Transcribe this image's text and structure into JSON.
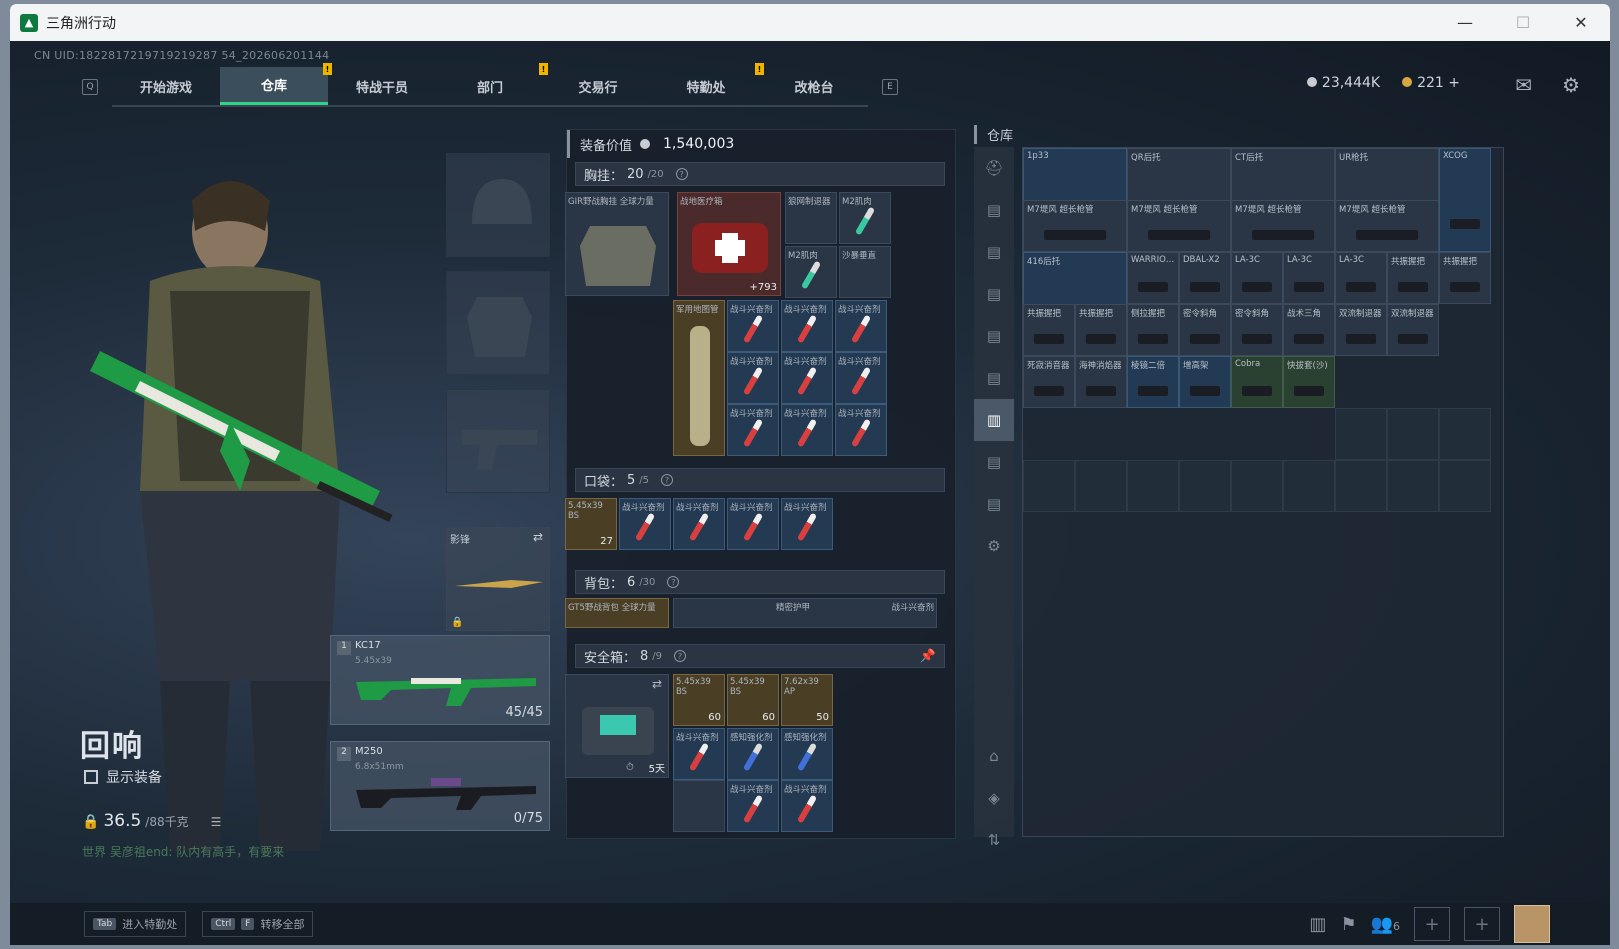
{
  "window": {
    "title": "三角洲行动",
    "controls": [
      "—",
      "☐",
      "✕"
    ]
  },
  "uid": "CN UID:1822817219719219287 54_202606201144",
  "nav": {
    "left_key": "Q",
    "right_key": "E",
    "tabs": [
      {
        "label": "开始游戏",
        "warn": false
      },
      {
        "label": "仓库",
        "warn": true,
        "active": true
      },
      {
        "label": "特战干员",
        "warn": false
      },
      {
        "label": "部门",
        "warn": true
      },
      {
        "label": "交易行",
        "warn": false
      },
      {
        "label": "特勤处",
        "warn": true
      },
      {
        "label": "改枪台",
        "warn": false
      }
    ],
    "warn_glyph": "!"
  },
  "currency": {
    "silver": "23,444K",
    "gold": "221",
    "add": "+"
  },
  "top_icons": [
    "mail-icon",
    "gear-icon"
  ],
  "character": {
    "name": "回响",
    "show_equipment": "显示装备",
    "weight": "36.5",
    "weight_max": "/88千克",
    "chat": "世界 吴彦祖end: 队内有高手，有要来"
  },
  "melee": {
    "label": "影锋"
  },
  "weapons": [
    {
      "slot": "1",
      "name": "KC17",
      "caliber": "5.45x39",
      "ammo": "45/45"
    },
    {
      "slot": "2",
      "name": "M250",
      "caliber": "6.8x51mm",
      "ammo": "0/75"
    }
  ],
  "equipment": {
    "header": "装备价值",
    "value": "1,540,003",
    "chest": {
      "label": "胸挂：",
      "count": "20",
      "cap": "/20"
    },
    "pocket": {
      "label": "口袋：",
      "count": "5",
      "cap": "/5"
    },
    "backpack": {
      "label": "背包：",
      "count": "6",
      "cap": "/30"
    },
    "safebox": {
      "label": "安全箱：",
      "count": "8",
      "cap": "/9",
      "timer": "5天"
    },
    "items": {
      "rig": "GIR野战胸挂 全球力量",
      "medkit": "战地医疗箱",
      "medkit_count": "+793",
      "silencer": "狼网制退器",
      "m2a": "M2肌肉",
      "m2b": "M2肌肉",
      "sand": "沙暴垂直",
      "tube": "军用地图管",
      "stim": "战斗兴奋剂",
      "ammo545": "5.45x39 BS",
      "ammo545_count": "27",
      "bag": "GT5野战背包 全球力量",
      "armor": "精密护甲",
      "safe_a": "5.45x39 BS",
      "safe_a_count": "60",
      "safe_b": "5.45x39 BS",
      "safe_b_count": "60",
      "safe_c": "7.62x39 AP",
      "safe_c_count": "50",
      "perc": "感知强化剂"
    }
  },
  "warehouse": {
    "title": "仓库",
    "items": [
      "1p33",
      "QR后托",
      "CT后托",
      "UR枪托",
      "XCOG",
      "M7堤风 超长枪管",
      "M7堤风 超长枪管",
      "M7堤风 超长枪管",
      "M7堤风 超长枪管",
      "416后托",
      "WARRIO…",
      "DBAL-X2",
      "LA-3C",
      "LA-3C",
      "LA-3C",
      "共振握把",
      "共振握把",
      "共振握把",
      "共振握把",
      "侧拉握把",
      "密令斜角",
      "密令斜角",
      "战术三角",
      "双流制退器",
      "双流制退器",
      "死寂消音器",
      "海神消焰器",
      "棱镜二倍",
      "增高架",
      "Cobra",
      "快拔套(沙)",
      "416后握"
    ]
  },
  "bottom": {
    "hint1_key": "Tab",
    "hint1": "进入特勤处",
    "hint2_key1": "Ctrl",
    "hint2_key2": "F",
    "hint2": "转移全部",
    "team_count": "6"
  }
}
